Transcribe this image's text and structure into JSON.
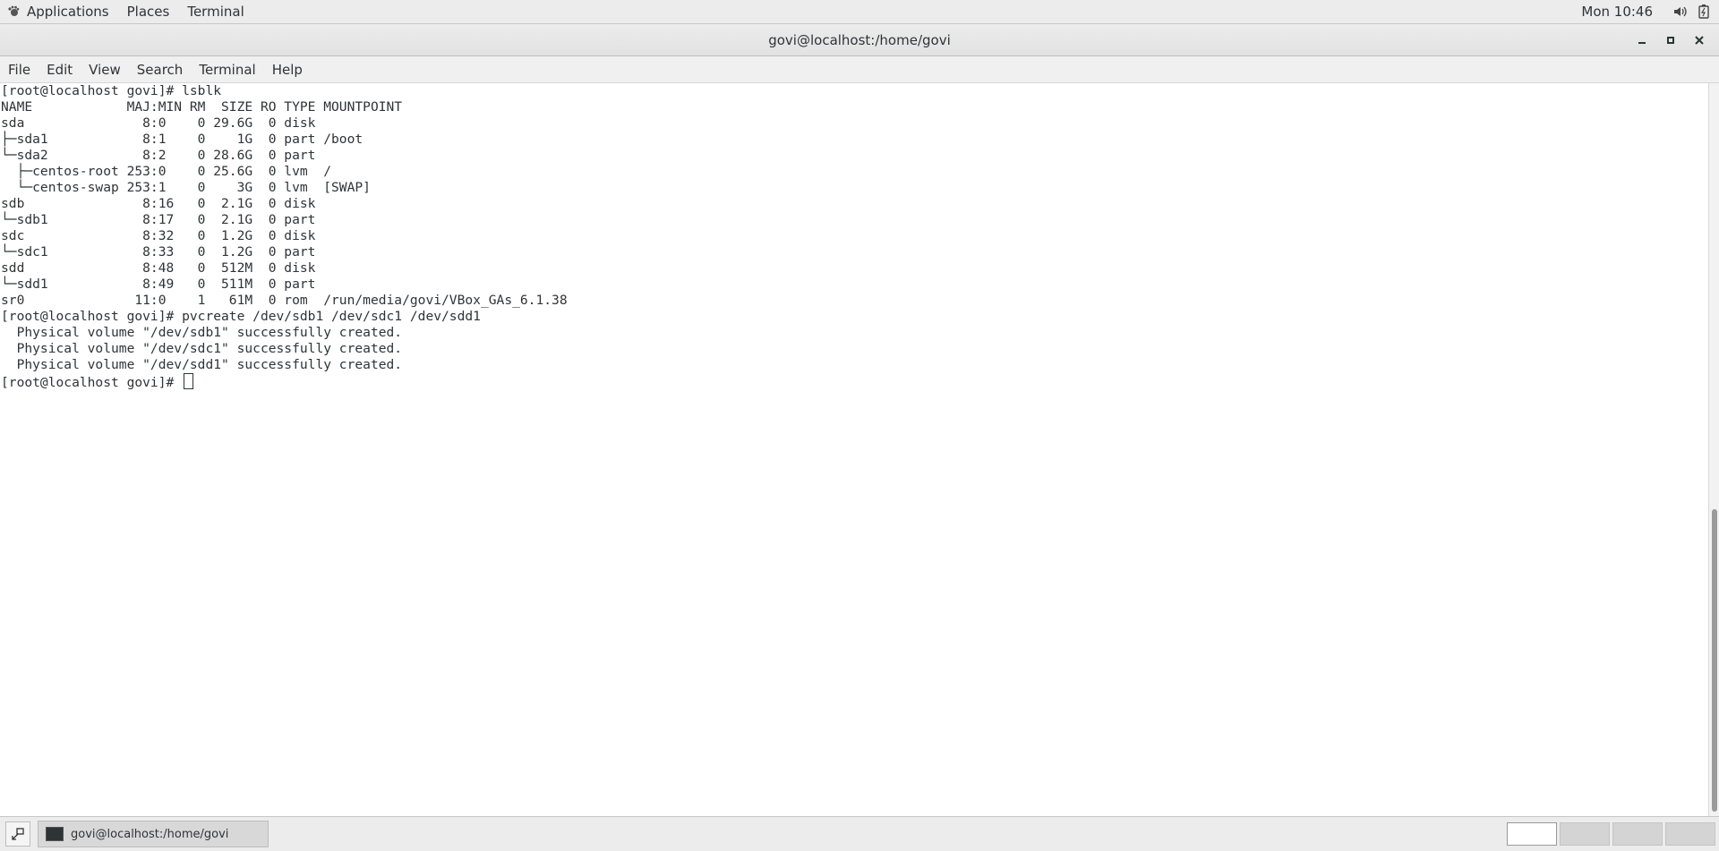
{
  "top_panel": {
    "menus": [
      "Applications",
      "Places",
      "Terminal"
    ],
    "clock": "Mon 10:46",
    "icons": [
      "volume-icon",
      "battery-icon"
    ]
  },
  "window": {
    "title": "govi@localhost:/home/govi",
    "controls": [
      "minimize-icon",
      "maximize-icon",
      "close-icon"
    ]
  },
  "menubar": {
    "items": [
      "File",
      "Edit",
      "View",
      "Search",
      "Terminal",
      "Help"
    ]
  },
  "terminal": {
    "lines": [
      "[root@localhost govi]# lsblk",
      "NAME            MAJ:MIN RM  SIZE RO TYPE MOUNTPOINT",
      "sda               8:0    0 29.6G  0 disk ",
      "├─sda1            8:1    0    1G  0 part /boot",
      "└─sda2            8:2    0 28.6G  0 part ",
      "  ├─centos-root 253:0    0 25.6G  0 lvm  /",
      "  └─centos-swap 253:1    0    3G  0 lvm  [SWAP]",
      "sdb               8:16   0  2.1G  0 disk ",
      "└─sdb1            8:17   0  2.1G  0 part ",
      "sdc               8:32   0  1.2G  0 disk ",
      "└─sdc1            8:33   0  1.2G  0 part ",
      "sdd               8:48   0  512M  0 disk ",
      "└─sdd1            8:49   0  511M  0 part ",
      "sr0              11:0    1   61M  0 rom  /run/media/govi/VBox_GAs_6.1.38",
      "[root@localhost govi]# pvcreate /dev/sdb1 /dev/sdc1 /dev/sdd1",
      "  Physical volume \"/dev/sdb1\" successfully created.",
      "  Physical volume \"/dev/sdc1\" successfully created.",
      "  Physical volume \"/dev/sdd1\" successfully created."
    ],
    "prompt": "[root@localhost govi]# "
  },
  "taskbar": {
    "task_label": "govi@localhost:/home/govi",
    "workspaces": 4,
    "active_workspace": 1
  }
}
